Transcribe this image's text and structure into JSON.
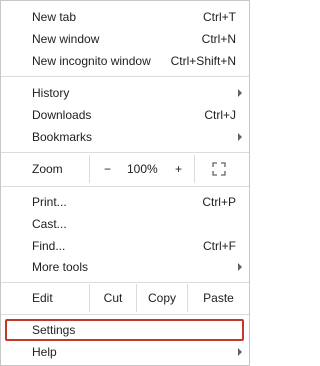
{
  "menu": {
    "group1": [
      {
        "label": "New tab",
        "shortcut": "Ctrl+T"
      },
      {
        "label": "New window",
        "shortcut": "Ctrl+N"
      },
      {
        "label": "New incognito window",
        "shortcut": "Ctrl+Shift+N"
      }
    ],
    "group2": [
      {
        "label": "History",
        "submenu": true
      },
      {
        "label": "Downloads",
        "shortcut": "Ctrl+J"
      },
      {
        "label": "Bookmarks",
        "submenu": true
      }
    ],
    "zoom": {
      "label": "Zoom",
      "minus": "−",
      "value": "100%",
      "plus": "+",
      "fullscreen_icon": "fullscreen-icon"
    },
    "group3": [
      {
        "label": "Print...",
        "shortcut": "Ctrl+P"
      },
      {
        "label": "Cast..."
      },
      {
        "label": "Find...",
        "shortcut": "Ctrl+F"
      },
      {
        "label": "More tools",
        "submenu": true
      }
    ],
    "edit": {
      "label": "Edit",
      "cut": "Cut",
      "copy": "Copy",
      "paste": "Paste"
    },
    "group4": [
      {
        "label": "Settings",
        "highlighted": true
      },
      {
        "label": "Help",
        "submenu": true
      }
    ],
    "colors": {
      "highlight_border": "#c0392b",
      "separator": "#dadce0",
      "text": "#202124"
    }
  }
}
